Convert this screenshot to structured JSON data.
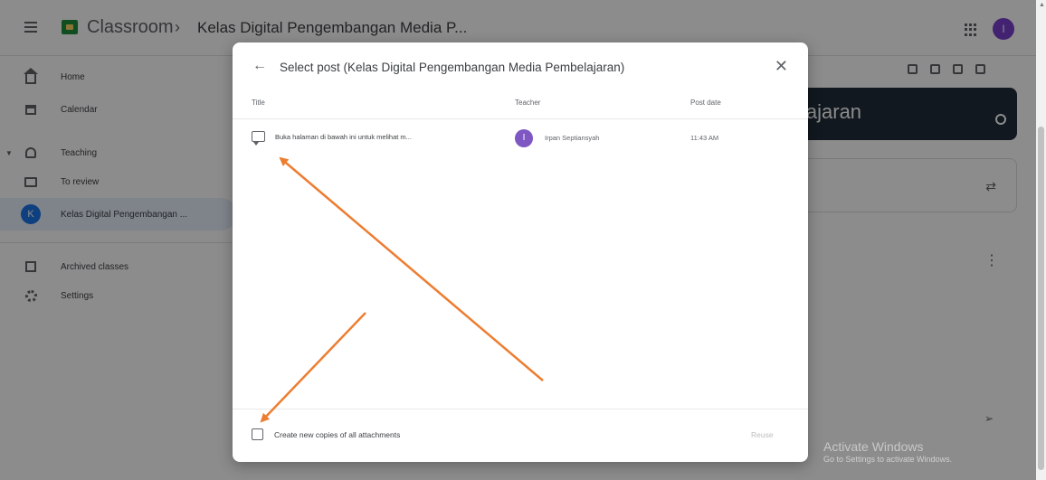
{
  "topbar": {
    "app_title": "Classroom",
    "crumb_sep": "›",
    "class_title": "Kelas Digital Pengembangan Media P...",
    "avatar_letter": "I"
  },
  "sidebar": {
    "items": [
      {
        "label": "Home",
        "icon": "home-icon"
      },
      {
        "label": "Calendar",
        "icon": "calendar-icon"
      },
      {
        "label": "Teaching",
        "icon": "people-icon"
      },
      {
        "label": "To review",
        "icon": "folder-icon"
      },
      {
        "label": "Kelas Digital Pengembangan ...",
        "icon": "class-avatar",
        "letter": "K"
      },
      {
        "label": "Archived classes",
        "icon": "archive-icon"
      },
      {
        "label": "Settings",
        "icon": "gear-icon"
      }
    ]
  },
  "main": {
    "banner_text": "lajaran",
    "watermark_title": "Activate Windows",
    "watermark_sub": "Go to Settings to activate Windows."
  },
  "dialog": {
    "title": "Select post (Kelas Digital Pengembangan Media Pembelajaran)",
    "columns": {
      "title": "Title",
      "teacher": "Teacher",
      "date": "Post date"
    },
    "rows": [
      {
        "title": "Buka halaman di bawah ini untuk melihat m...",
        "teacher_initial": "I",
        "teacher": "Irpan Septiansyah",
        "date": "11:43 AM"
      }
    ],
    "checkbox_label": "Create new copies of all attachments",
    "reuse_label": "Reuse"
  },
  "colors": {
    "annotation_arrow": "#ed7d31",
    "scrim": "#000000",
    "accent": "#1a73e8",
    "avatar": "#7e57c2"
  }
}
